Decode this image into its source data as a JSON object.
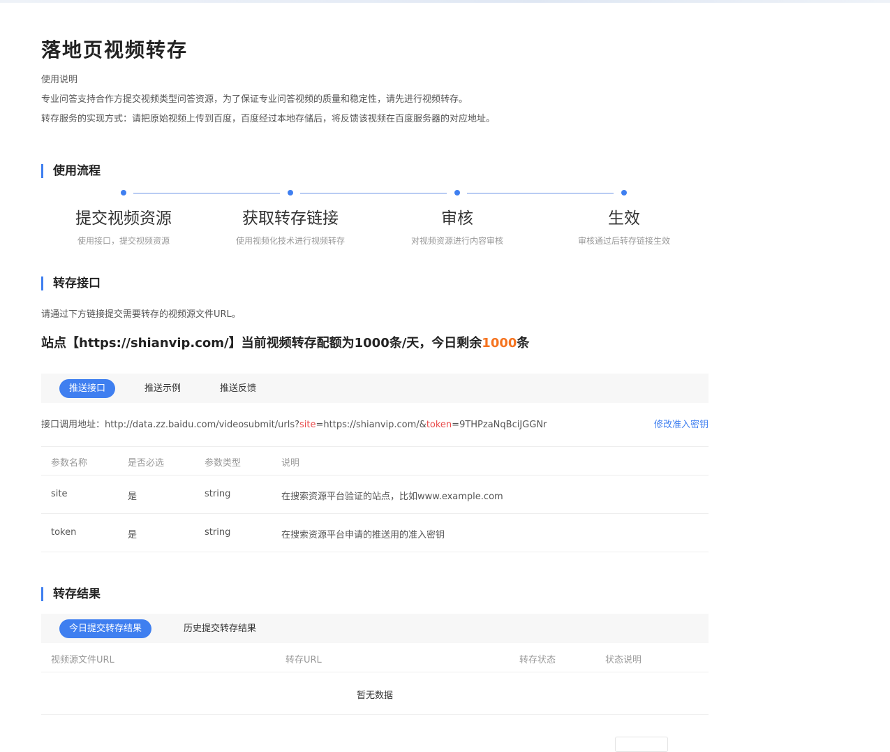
{
  "page": {
    "title": "落地页视频转存",
    "intro": [
      "使用说明",
      "专业问答支持合作方提交视频类型问答资源，为了保证专业问答视频的质量和稳定性，请先进行视频转存。",
      "转存服务的实现方式：请把原始视频上传到百度，百度经过本地存储后，将反馈该视频在百度服务器的对应地址。"
    ]
  },
  "process": {
    "title": "使用流程",
    "steps": [
      {
        "title": "提交视频资源",
        "desc": "使用接口，提交视频资源"
      },
      {
        "title": "获取转存链接",
        "desc": "使用视频化技术进行视频转存"
      },
      {
        "title": "审核",
        "desc": "对视频资源进行内容审核"
      },
      {
        "title": "生效",
        "desc": "审核通过后转存链接生效"
      }
    ]
  },
  "api": {
    "title": "转存接口",
    "desc": "请通过下方链接提交需要转存的视频源文件URL。",
    "quota_prefix": "站点【https://shianvip.com/】当前视频转存配额为1000条/天，今日剩余",
    "quota_remaining": "1000",
    "quota_suffix": "条",
    "tabs": [
      {
        "label": "推送接口",
        "active": true
      },
      {
        "label": "推送示例",
        "active": false
      },
      {
        "label": "推送反馈",
        "active": false
      }
    ],
    "url_label": "接口调用地址：",
    "url_base": "http://data.zz.baidu.com/videosubmit/urls?",
    "url_param1": "site",
    "url_value1": "=https://shianvip.com/&",
    "url_param2": "token",
    "url_value2": "=9THPzaNqBciJGGNr",
    "edit_key_label": "修改准入密钥",
    "table": {
      "headers": [
        "参数名称",
        "是否必选",
        "参数类型",
        "说明"
      ],
      "rows": [
        [
          "site",
          "是",
          "string",
          "在搜索资源平台验证的站点，比如www.example.com"
        ],
        [
          "token",
          "是",
          "string",
          "在搜索资源平台申请的推送用的准入密钥"
        ]
      ]
    }
  },
  "result": {
    "title": "转存结果",
    "tabs": [
      {
        "label": "今日提交转存结果",
        "active": true
      },
      {
        "label": "历史提交转存结果",
        "active": false
      }
    ],
    "headers": [
      "视频源文件URL",
      "转存URL",
      "转存状态",
      "状态说明"
    ],
    "empty_text": "暂无数据"
  },
  "colors": {
    "accent": "#3f7ff0",
    "highlight": "#f5731f",
    "param": "#e84a4a"
  }
}
